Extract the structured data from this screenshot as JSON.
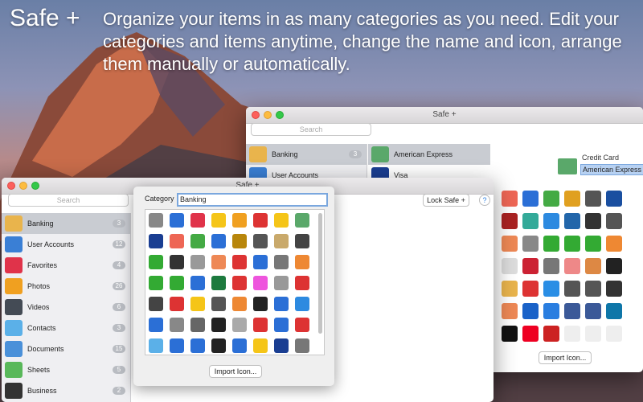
{
  "headline": {
    "app_name": "Safe +",
    "tagline": "Organize your items in as many categories as you need. Edit your categories and items anytime, change the name and icon, arrange them manually or automatically."
  },
  "back_window": {
    "title": "Safe +",
    "search_placeholder": "Search",
    "categories": [
      {
        "label": "Banking",
        "count": "3"
      },
      {
        "label": "User Accounts"
      }
    ],
    "items": [
      {
        "label": "American Express"
      },
      {
        "label": "Visa"
      }
    ],
    "detail_field_label": "Credit Card",
    "detail_field_value": "American Express",
    "import_label": "Import Icon..."
  },
  "front_window": {
    "title": "Safe +",
    "search_placeholder": "Search",
    "lock_label": "Lock Safe +",
    "help_label": "?",
    "categories": [
      {
        "label": "Banking",
        "count": "3",
        "color": "#e9b44c"
      },
      {
        "label": "User Accounts",
        "count": "12",
        "color": "#3a7fd5"
      },
      {
        "label": "Favorites",
        "count": "4",
        "color": "#e0334a"
      },
      {
        "label": "Photos",
        "count": "26",
        "color": "#f0a020"
      },
      {
        "label": "Videos",
        "count": "6",
        "color": "#444b55"
      },
      {
        "label": "Contacts",
        "count": "3",
        "color": "#5bb0e8"
      },
      {
        "label": "Documents",
        "count": "15",
        "color": "#4a90d9"
      },
      {
        "label": "Sheets",
        "count": "5",
        "color": "#59b85a"
      },
      {
        "label": "Business",
        "count": "2",
        "color": "#333"
      }
    ]
  },
  "popover": {
    "category_label": "Category",
    "category_value": "Banking",
    "import_label": "Import Icon..."
  }
}
